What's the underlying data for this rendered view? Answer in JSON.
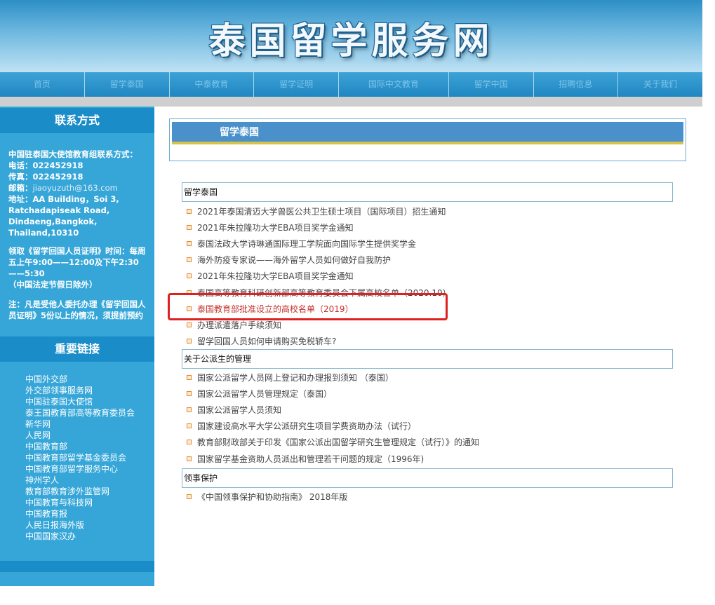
{
  "site_title": "泰国留学服务网",
  "nav": [
    "首页",
    "留学泰国",
    "中泰教育",
    "留学证明",
    "国际中文教育",
    "留学中国",
    "招聘信息",
    "关于我们"
  ],
  "sidebar": {
    "contact_title": "联系方式",
    "contact": {
      "intro": "中国驻泰国大使馆教育组联系方式：",
      "phone": "电话：022452918",
      "fax": "传真：022452918",
      "email_label": "邮箱：",
      "email": "jiaoyuzuth@163.com",
      "address": "地址：AA Building，Soi 3, Ratchadapiseak Road, Dindaeng,Bangkok, Thailand,10310",
      "hours": "领取《留学回国人员证明》时间：每周五上午9:00——12:00及下午2:30——5:30",
      "holiday": "（中国法定节假日除外）",
      "note": "注：凡是受他人委托办理《留学回国人员证明》5份以上的情况，须提前预约"
    },
    "links_title": "重要链接",
    "links": [
      "中国外交部",
      "外交部领事服务网",
      "中国驻泰国大使馆",
      "泰王国教育部高等教育委员会",
      "新华网",
      "人民网",
      "中国教育部",
      "中国教育部留学基金委员会",
      "中国教育部留学服务中心",
      "神州学人",
      "教育部教育涉外监管网",
      "中国教育与科技网",
      "中国教育报",
      "人民日报海外版",
      "中国国家汉办"
    ]
  },
  "main": {
    "section_title": "留学泰国",
    "categories": [
      {
        "name": "留学泰国",
        "items": [
          "2021年泰国清迈大学兽医公共卫生硕士项目（国际项目）招生通知",
          "2021年朱拉隆功大学EBA项目奖学金通知",
          "泰国法政大学诗琳通国际理工学院面向国际学生提供奖学金",
          "海外防疫专家说——海外留学人员如何做好自我防护",
          "2021年朱拉隆功大学EBA项目奖学金通知",
          "泰国高等教育科研创新部高等教育委员会下属高校名单（2020.10）",
          "泰国教育部批准设立的高校名单（2019）",
          "办理派遣落户手续须知",
          "留学回国人员如何申请购买免税轿车?"
        ]
      },
      {
        "name": "关于公派生的管理",
        "items": [
          "国家公派留学人员网上登记和办理报到须知 （泰国）",
          "国家公派留学人员管理规定（泰国）",
          "国家公派留学人员须知",
          "国家建设高水平大学公派研究生项目学费资助办法（试行）",
          "教育部财政部关于印发《国家公派出国留学研究生管理规定（试行）》的通知",
          "国家留学基金资助人员派出和管理若干问题的规定（1996年)"
        ]
      },
      {
        "name": "领事保护",
        "items": [
          "《中国领事保护和协助指南》 2018年版"
        ]
      }
    ]
  },
  "colors": {
    "nav_blue": "#1f86c1",
    "sidebar_blue": "#36a6d8",
    "highlight_red": "#e02020"
  }
}
